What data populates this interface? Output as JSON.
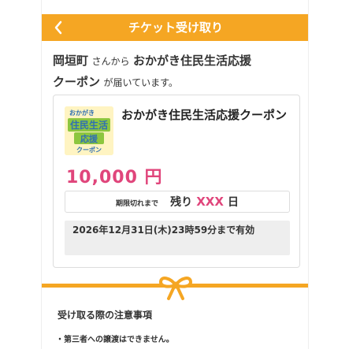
{
  "header": {
    "title": "チケット受け取り",
    "back_icon": "chevron-left-icon",
    "color": "#F5A623"
  },
  "intro": {
    "sender": "岡垣町",
    "from_text": "さんから",
    "coupon": "おかがき住民生活応援",
    "coupon_tail": "クーポン",
    "arrived_text": "が届いています。"
  },
  "card": {
    "image": {
      "line1": "おかがき",
      "line2": "住民生活",
      "line3": "応援",
      "line4": "クーポン"
    },
    "name": "おかがき住民生活応援クーポン",
    "amount": "10,000 円",
    "remaining": {
      "label": "期限切れまで",
      "prefix": "残り",
      "value": "XXX",
      "unit": "日"
    },
    "deadline": "2026年12月31日(木)23時59分まで有効"
  },
  "notice": {
    "title": "受け取る際の注意事項",
    "items": [
      "・第三者への譲渡はできません。"
    ]
  },
  "colors": {
    "accent": "#F5A623",
    "amount": "#E0457B",
    "remaining_value": "#E0457B"
  }
}
